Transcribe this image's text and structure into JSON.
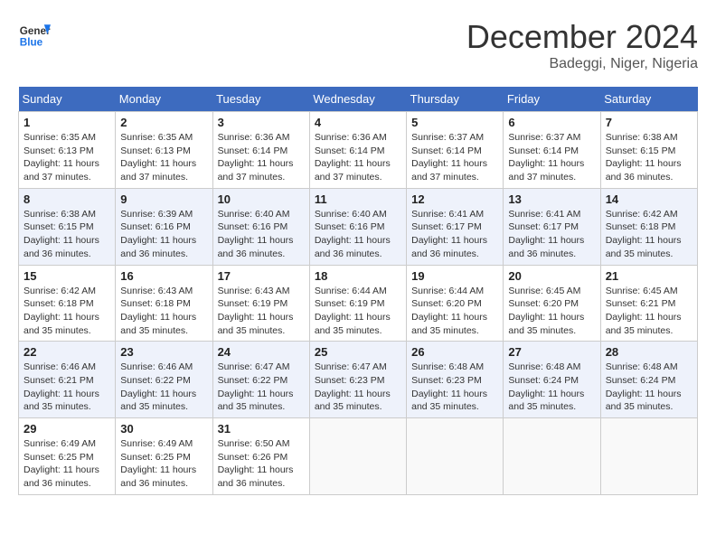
{
  "header": {
    "logo_general": "General",
    "logo_blue": "Blue",
    "month": "December 2024",
    "location": "Badeggi, Niger, Nigeria"
  },
  "days_of_week": [
    "Sunday",
    "Monday",
    "Tuesday",
    "Wednesday",
    "Thursday",
    "Friday",
    "Saturday"
  ],
  "weeks": [
    [
      {
        "day": "1",
        "sunrise": "6:35 AM",
        "sunset": "6:13 PM",
        "daylight": "11 hours and 37 minutes."
      },
      {
        "day": "2",
        "sunrise": "6:35 AM",
        "sunset": "6:13 PM",
        "daylight": "11 hours and 37 minutes."
      },
      {
        "day": "3",
        "sunrise": "6:36 AM",
        "sunset": "6:14 PM",
        "daylight": "11 hours and 37 minutes."
      },
      {
        "day": "4",
        "sunrise": "6:36 AM",
        "sunset": "6:14 PM",
        "daylight": "11 hours and 37 minutes."
      },
      {
        "day": "5",
        "sunrise": "6:37 AM",
        "sunset": "6:14 PM",
        "daylight": "11 hours and 37 minutes."
      },
      {
        "day": "6",
        "sunrise": "6:37 AM",
        "sunset": "6:14 PM",
        "daylight": "11 hours and 37 minutes."
      },
      {
        "day": "7",
        "sunrise": "6:38 AM",
        "sunset": "6:15 PM",
        "daylight": "11 hours and 36 minutes."
      }
    ],
    [
      {
        "day": "8",
        "sunrise": "6:38 AM",
        "sunset": "6:15 PM",
        "daylight": "11 hours and 36 minutes."
      },
      {
        "day": "9",
        "sunrise": "6:39 AM",
        "sunset": "6:16 PM",
        "daylight": "11 hours and 36 minutes."
      },
      {
        "day": "10",
        "sunrise": "6:40 AM",
        "sunset": "6:16 PM",
        "daylight": "11 hours and 36 minutes."
      },
      {
        "day": "11",
        "sunrise": "6:40 AM",
        "sunset": "6:16 PM",
        "daylight": "11 hours and 36 minutes."
      },
      {
        "day": "12",
        "sunrise": "6:41 AM",
        "sunset": "6:17 PM",
        "daylight": "11 hours and 36 minutes."
      },
      {
        "day": "13",
        "sunrise": "6:41 AM",
        "sunset": "6:17 PM",
        "daylight": "11 hours and 36 minutes."
      },
      {
        "day": "14",
        "sunrise": "6:42 AM",
        "sunset": "6:18 PM",
        "daylight": "11 hours and 35 minutes."
      }
    ],
    [
      {
        "day": "15",
        "sunrise": "6:42 AM",
        "sunset": "6:18 PM",
        "daylight": "11 hours and 35 minutes."
      },
      {
        "day": "16",
        "sunrise": "6:43 AM",
        "sunset": "6:18 PM",
        "daylight": "11 hours and 35 minutes."
      },
      {
        "day": "17",
        "sunrise": "6:43 AM",
        "sunset": "6:19 PM",
        "daylight": "11 hours and 35 minutes."
      },
      {
        "day": "18",
        "sunrise": "6:44 AM",
        "sunset": "6:19 PM",
        "daylight": "11 hours and 35 minutes."
      },
      {
        "day": "19",
        "sunrise": "6:44 AM",
        "sunset": "6:20 PM",
        "daylight": "11 hours and 35 minutes."
      },
      {
        "day": "20",
        "sunrise": "6:45 AM",
        "sunset": "6:20 PM",
        "daylight": "11 hours and 35 minutes."
      },
      {
        "day": "21",
        "sunrise": "6:45 AM",
        "sunset": "6:21 PM",
        "daylight": "11 hours and 35 minutes."
      }
    ],
    [
      {
        "day": "22",
        "sunrise": "6:46 AM",
        "sunset": "6:21 PM",
        "daylight": "11 hours and 35 minutes."
      },
      {
        "day": "23",
        "sunrise": "6:46 AM",
        "sunset": "6:22 PM",
        "daylight": "11 hours and 35 minutes."
      },
      {
        "day": "24",
        "sunrise": "6:47 AM",
        "sunset": "6:22 PM",
        "daylight": "11 hours and 35 minutes."
      },
      {
        "day": "25",
        "sunrise": "6:47 AM",
        "sunset": "6:23 PM",
        "daylight": "11 hours and 35 minutes."
      },
      {
        "day": "26",
        "sunrise": "6:48 AM",
        "sunset": "6:23 PM",
        "daylight": "11 hours and 35 minutes."
      },
      {
        "day": "27",
        "sunrise": "6:48 AM",
        "sunset": "6:24 PM",
        "daylight": "11 hours and 35 minutes."
      },
      {
        "day": "28",
        "sunrise": "6:48 AM",
        "sunset": "6:24 PM",
        "daylight": "11 hours and 35 minutes."
      }
    ],
    [
      {
        "day": "29",
        "sunrise": "6:49 AM",
        "sunset": "6:25 PM",
        "daylight": "11 hours and 36 minutes."
      },
      {
        "day": "30",
        "sunrise": "6:49 AM",
        "sunset": "6:25 PM",
        "daylight": "11 hours and 36 minutes."
      },
      {
        "day": "31",
        "sunrise": "6:50 AM",
        "sunset": "6:26 PM",
        "daylight": "11 hours and 36 minutes."
      },
      null,
      null,
      null,
      null
    ]
  ]
}
